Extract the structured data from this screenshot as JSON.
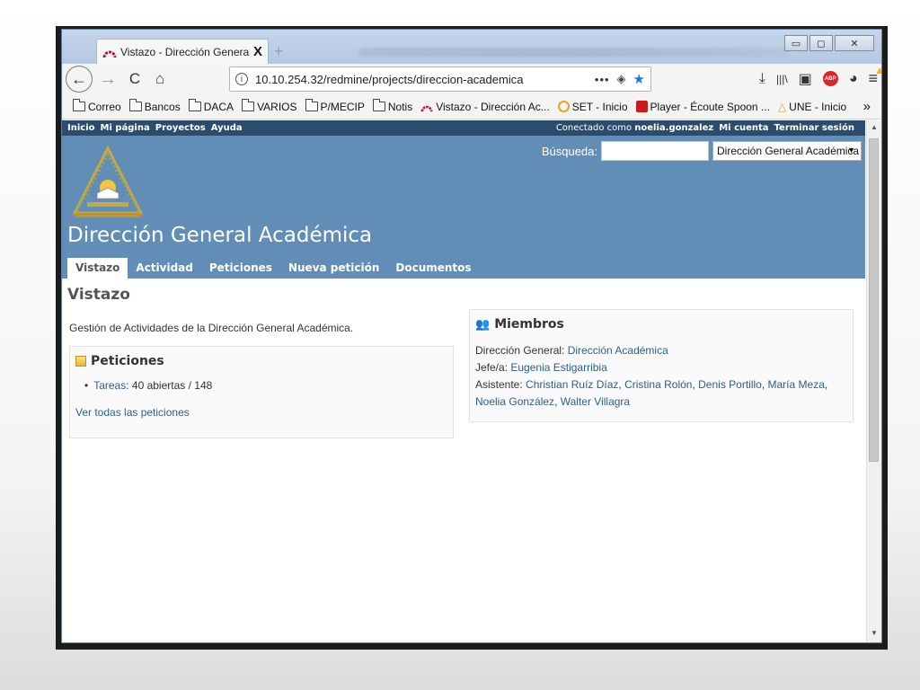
{
  "browser": {
    "tab_title": "Vistazo - Dirección General Aca",
    "tab_close": "X",
    "new_tab": "+",
    "window_controls": {
      "minimize": "▭",
      "maximize": "◻",
      "close": "✕"
    },
    "nav": {
      "back": "←",
      "forward": "→",
      "reload": "C",
      "home": "⌂",
      "url": "10.10.254.32/redmine/projects/direccion-academica",
      "info_icon": "i",
      "dots": "•••",
      "pocket": "◈",
      "star": "★",
      "download": "⤓",
      "library": "|||\\",
      "sidebar": "▣",
      "abp": "ABP",
      "ext": "◕",
      "menu": "≡",
      "menu_warning": "▲"
    },
    "bookmarks": [
      {
        "label": "Correo",
        "icon": "folder-icon"
      },
      {
        "label": "Bancos",
        "icon": "folder-icon"
      },
      {
        "label": "DACA",
        "icon": "folder-icon"
      },
      {
        "label": "VARIOS",
        "icon": "folder-icon"
      },
      {
        "label": "P/MECIP",
        "icon": "folder-icon"
      },
      {
        "label": "Notis",
        "icon": "folder-icon"
      },
      {
        "label": "Vistazo - Dirección Ac...",
        "icon": "redmine-icon"
      },
      {
        "label": "SET - Inicio",
        "icon": "set-icon"
      },
      {
        "label": "Player - Écoute Spoon ...",
        "icon": "player-icon"
      },
      {
        "label": "UNE - Inicio",
        "icon": "une-icon"
      }
    ],
    "bookmarks_more": "»"
  },
  "redmine": {
    "top_menu": [
      "Inicio",
      "Mi página",
      "Proyectos",
      "Ayuda"
    ],
    "logged_as_prefix": "Conectado como",
    "logged_user": "noelia.gonzalez",
    "my_account": "Mi cuenta",
    "logout": "Terminar sesión",
    "search_label": "Búsqueda:",
    "search_value": "",
    "project_jump": "Dirección General Académica",
    "project_title": "Dirección General Académica",
    "main_menu": [
      "Vistazo",
      "Actividad",
      "Peticiones",
      "Nueva petición",
      "Documentos"
    ],
    "selected_tab": "Vistazo",
    "page_title": "Vistazo",
    "description": "Gestión de Actividades de la Dirección General Académica.",
    "issues_box": {
      "title": "Peticiones",
      "tracker_link": "Tareas",
      "tracker_counts": ": 40 abiertas / 148",
      "view_all": "Ver todas las peticiones"
    },
    "members_box": {
      "title": "Miembros",
      "roles": [
        {
          "role": "Dirección General:",
          "members": [
            "Dirección Académica"
          ]
        },
        {
          "role": "Jefe/a:",
          "members": [
            "Eugenia Estigarribia"
          ]
        },
        {
          "role": "Asistente:",
          "members": [
            "Christian Ruíz Díaz",
            "Cristina Rolón",
            "Denis Portillo",
            "María Meza",
            "Noelia González",
            "Walter Villagra"
          ]
        }
      ]
    }
  },
  "colors": {
    "header_bg": "#628db6",
    "top_menu_bg": "#2c4c6e",
    "link": "#2c5f8d"
  }
}
